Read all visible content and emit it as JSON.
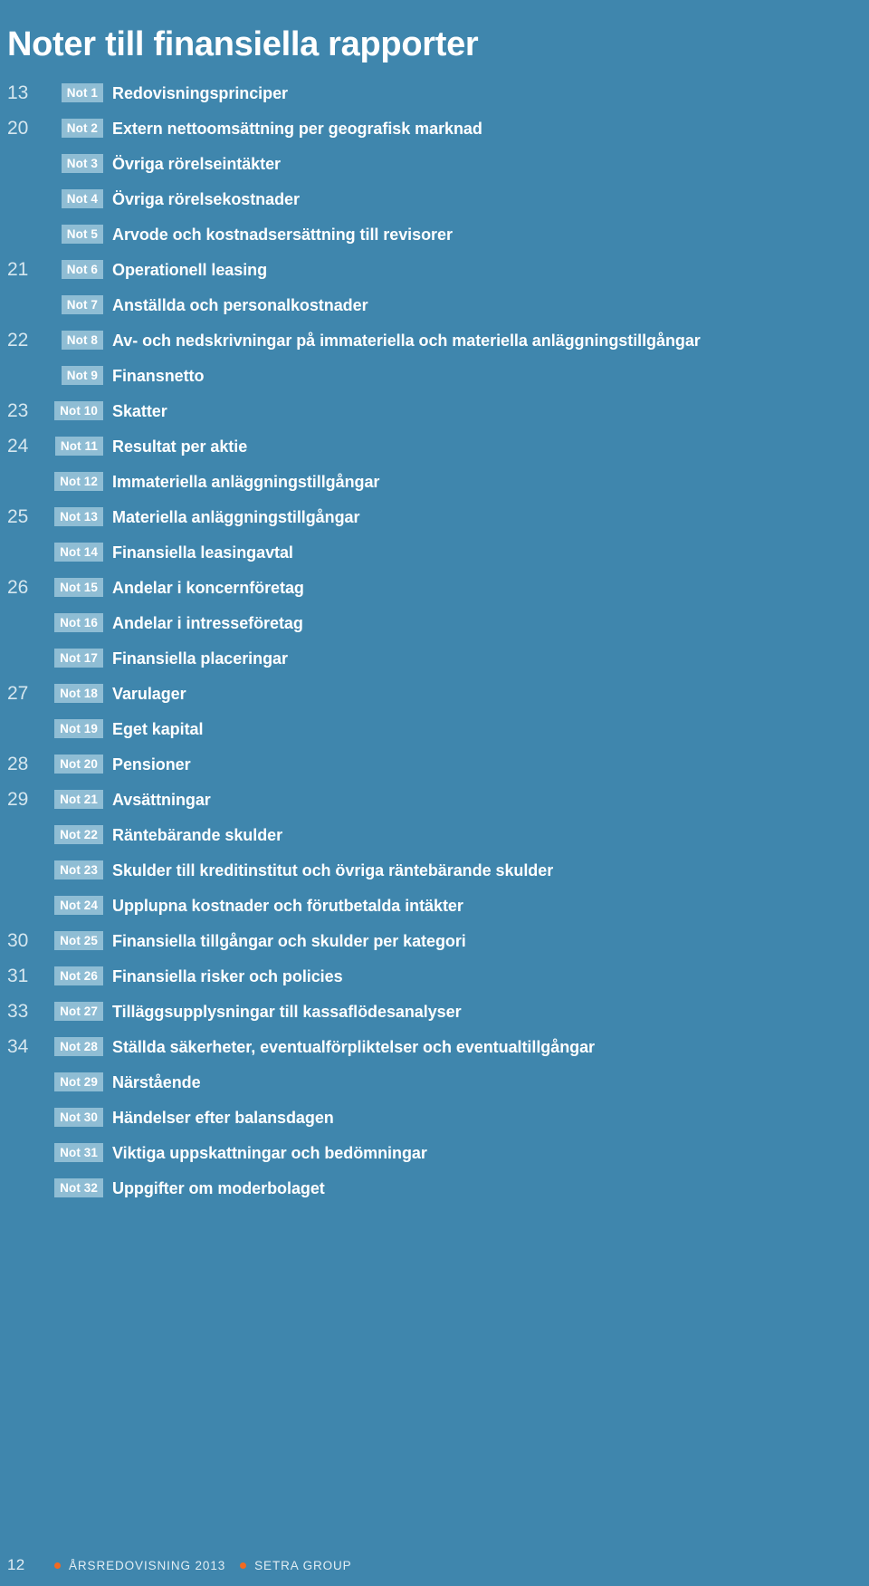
{
  "document": {
    "title": "Noter till finansiella rapporter"
  },
  "notes": [
    {
      "page": "13",
      "badge": "Not 1",
      "title": "Redovisningsprinciper"
    },
    {
      "page": "20",
      "badge": "Not 2",
      "title": "Extern nettoomsättning per geografisk marknad"
    },
    {
      "page": "",
      "badge": "Not 3",
      "title": "Övriga rörelseintäkter"
    },
    {
      "page": "",
      "badge": "Not 4",
      "title": "Övriga rörelsekostnader"
    },
    {
      "page": "",
      "badge": "Not 5",
      "title": "Arvode och kostnadsersättning till revisorer"
    },
    {
      "page": "21",
      "badge": "Not 6",
      "title": "Operationell leasing"
    },
    {
      "page": "",
      "badge": "Not 7",
      "title": "Anställda och personalkostnader"
    },
    {
      "page": "22",
      "badge": "Not 8",
      "title": "Av- och nedskrivningar på immateriella och materiella anläggningstillgångar"
    },
    {
      "page": "",
      "badge": "Not 9",
      "title": "Finansnetto"
    },
    {
      "page": "23",
      "badge": "Not 10",
      "title": "Skatter"
    },
    {
      "page": "24",
      "badge": "Not 11",
      "title": "Resultat per aktie"
    },
    {
      "page": "",
      "badge": "Not 12",
      "title": "Immateriella anläggningstillgångar"
    },
    {
      "page": "25",
      "badge": "Not 13",
      "title": "Materiella anläggningstillgångar"
    },
    {
      "page": "",
      "badge": "Not 14",
      "title": "Finansiella leasingavtal"
    },
    {
      "page": "26",
      "badge": "Not 15",
      "title": "Andelar i koncernföretag"
    },
    {
      "page": "",
      "badge": "Not 16",
      "title": "Andelar i intresseföretag"
    },
    {
      "page": "",
      "badge": "Not 17",
      "title": "Finansiella placeringar"
    },
    {
      "page": "27",
      "badge": "Not 18",
      "title": "Varulager"
    },
    {
      "page": "",
      "badge": "Not 19",
      "title": "Eget kapital"
    },
    {
      "page": "28",
      "badge": "Not 20",
      "title": "Pensioner"
    },
    {
      "page": "29",
      "badge": "Not 21",
      "title": "Avsättningar"
    },
    {
      "page": "",
      "badge": "Not 22",
      "title": "Räntebärande skulder"
    },
    {
      "page": "",
      "badge": "Not 23",
      "title": "Skulder till kreditinstitut och övriga räntebärande skulder"
    },
    {
      "page": "",
      "badge": "Not 24",
      "title": "Upplupna kostnader och förutbetalda intäkter"
    },
    {
      "page": "30",
      "badge": "Not 25",
      "title": "Finansiella tillgångar och skulder per kategori"
    },
    {
      "page": "31",
      "badge": "Not 26",
      "title": "Finansiella risker och policies"
    },
    {
      "page": "33",
      "badge": "Not 27",
      "title": "Tilläggsupplysningar till kassaflödesanalyser"
    },
    {
      "page": "34",
      "badge": "Not 28",
      "title": "Ställda säkerheter, eventualförpliktelser och eventualtillgångar"
    },
    {
      "page": "",
      "badge": "Not 29",
      "title": "Närstående"
    },
    {
      "page": "",
      "badge": "Not 30",
      "title": "Händelser efter balansdagen"
    },
    {
      "page": "",
      "badge": "Not 31",
      "title": "Viktiga uppskattningar och bedömningar"
    },
    {
      "page": "",
      "badge": "Not 32",
      "title": "Uppgifter om moderbolaget"
    }
  ],
  "footer": {
    "page_number": "12",
    "report_label": "ÅRSREDOVISNING 2013",
    "company_label": "SETRA GROUP",
    "bullet_icon": "orange-dot-icon"
  },
  "colors": {
    "background": "#3f86ad",
    "badge_background": "#8fbdd4",
    "text": "#ffffff",
    "page_number_text": "#d6e7ef",
    "footer_accent": "#f26a21"
  }
}
